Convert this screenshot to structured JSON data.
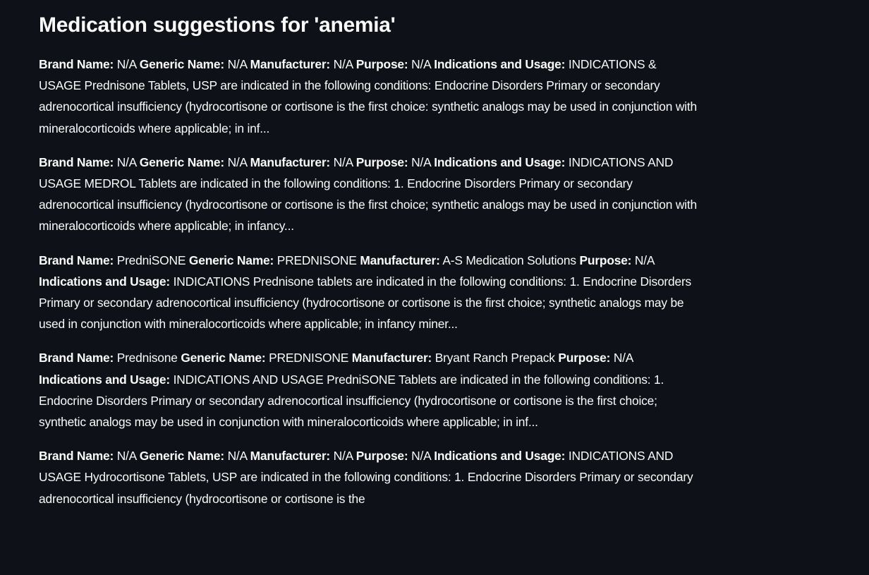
{
  "title": "Medication suggestions for 'anemia'",
  "labels": {
    "brand": "Brand Name:",
    "generic": "Generic Name:",
    "manufacturer": "Manufacturer:",
    "purpose": "Purpose:",
    "indications": "Indications and Usage:"
  },
  "results": [
    {
      "brand": "N/A",
      "generic": "N/A",
      "manufacturer": "N/A",
      "purpose": "N/A",
      "indications": "INDICATIONS & USAGE Prednisone Tablets, USP are indicated in the following conditions: Endocrine Disorders Primary or secondary adrenocortical insufficiency (hydrocortisone or cortisone is the first choice: synthetic analogs may be used in conjunction with mineralocorticoids where applicable; in inf..."
    },
    {
      "brand": "N/A",
      "generic": "N/A",
      "manufacturer": "N/A",
      "purpose": "N/A",
      "indications": "INDICATIONS AND USAGE MEDROL Tablets are indicated in the following conditions: 1. Endocrine Disorders Primary or secondary adrenocortical insufficiency (hydrocortisone or cortisone is the first choice; synthetic analogs may be used in conjunction with mineralocorticoids where applicable; in infancy..."
    },
    {
      "brand": "PredniSONE",
      "generic": "PREDNISONE",
      "manufacturer": "A-S Medication Solutions",
      "purpose": "N/A",
      "indications": "INDICATIONS Prednisone tablets are indicated in the following conditions: 1. Endocrine Disorders Primary or secondary adrenocortical insufficiency (hydrocortisone or cortisone is the first choice; synthetic analogs may be used in conjunction with mineralocorticoids where applicable; in infancy miner..."
    },
    {
      "brand": "Prednisone",
      "generic": "PREDNISONE",
      "manufacturer": "Bryant Ranch Prepack",
      "purpose": "N/A",
      "indications": "INDICATIONS AND USAGE PredniSONE Tablets are indicated in the following conditions: 1. Endocrine Disorders Primary or secondary adrenocortical insufficiency (hydrocortisone or cortisone is the first choice; synthetic analogs may be used in conjunction with mineralocorticoids where applicable; in inf..."
    },
    {
      "brand": "N/A",
      "generic": "N/A",
      "manufacturer": "N/A",
      "purpose": "N/A",
      "indications": "INDICATIONS AND USAGE Hydrocortisone Tablets, USP are indicated in the following conditions: 1. Endocrine Disorders Primary or secondary adrenocortical insufficiency (hydrocortisone or cortisone is the"
    }
  ]
}
